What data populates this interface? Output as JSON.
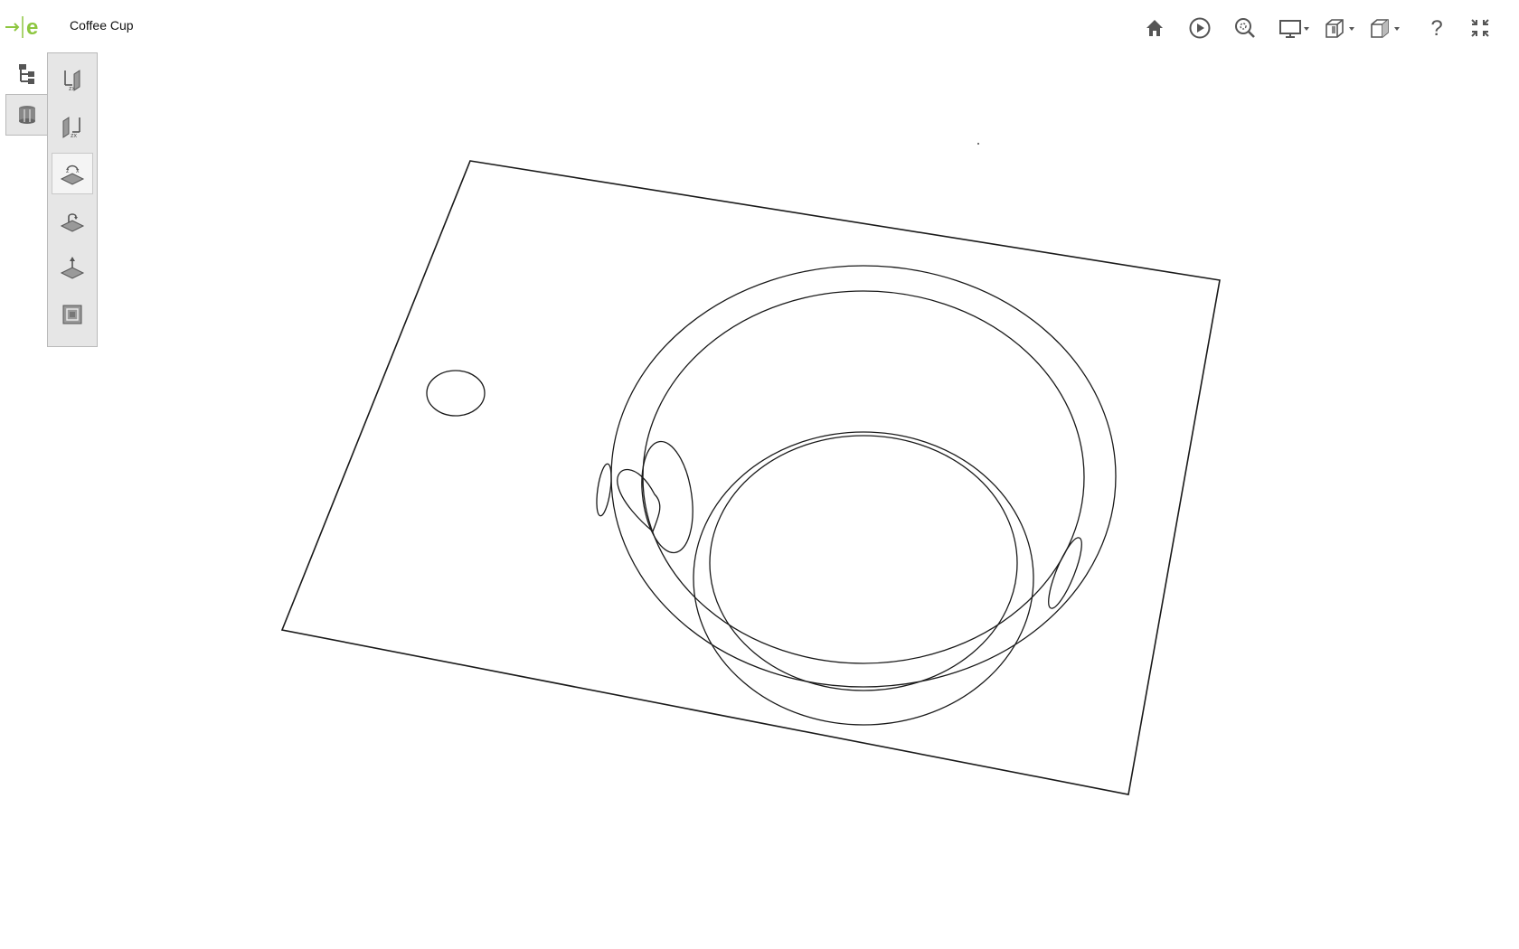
{
  "header": {
    "title": "Coffee Cup",
    "logo_icon": "onshape-arrow-e-logo",
    "accent": "#8dc63f"
  },
  "toolbar": {
    "items": [
      {
        "name": "home-icon"
      },
      {
        "name": "play-icon"
      },
      {
        "name": "zoom-fit-icon"
      },
      {
        "name": "display-monitor-icon"
      },
      {
        "name": "section-view-icon"
      },
      {
        "name": "view-cube-icon"
      },
      {
        "name": "help-icon"
      },
      {
        "name": "fullscreen-collapse-icon"
      }
    ]
  },
  "left_tabs": [
    {
      "name": "feature-tree-icon"
    },
    {
      "name": "part-cylinder-icon"
    }
  ],
  "tools": [
    {
      "name": "rotate-axis-x-icon"
    },
    {
      "name": "rotate-axis-z-icon"
    },
    {
      "name": "plane-rotate-zx-icon",
      "selected": true
    },
    {
      "name": "plane-turn-icon"
    },
    {
      "name": "plane-normal-up-icon"
    },
    {
      "name": "layers-box-icon"
    }
  ],
  "viewport": {
    "model": "Coffee Cup",
    "render_mode": "wireframe",
    "edge_color": "#222222",
    "background": "#ffffff"
  }
}
